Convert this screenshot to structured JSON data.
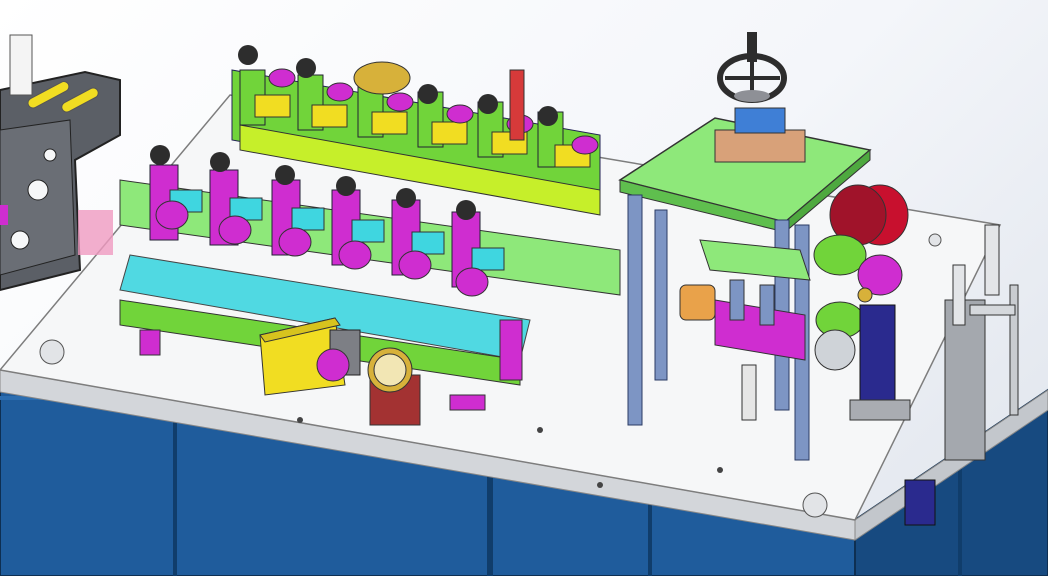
{
  "viewport": {
    "background_top": "#ffffff",
    "background_bottom": "#dfe4ec"
  },
  "machine": {
    "colors": {
      "table_top": "#f6f7f8",
      "table_edge": "#d3d6da",
      "cabinet": "#1f5c9c",
      "cabinet_dark": "#174a80",
      "frame_gray": "#5b5f66",
      "green": "#71d43a",
      "lime": "#c6ef2a",
      "magenta": "#cf2dd0",
      "cyan": "#3fd6e0",
      "yellow": "#f1dd22",
      "light_green": "#8ee87a",
      "column_blue": "#7d95c4",
      "red": "#d63a3a",
      "gold": "#d7b13a",
      "navy": "#2a2a8e",
      "dark_knob": "#2d2d2d",
      "maroon": "#a33232",
      "pink": "#f09ac0",
      "orange": "#e9a24a",
      "tan": "#d8a179"
    },
    "components": [
      "work-table",
      "base-cabinet",
      "left-spool-frame",
      "upper-clamp-row",
      "lower-clamp-row",
      "motor-box",
      "dial-gauge",
      "press-plate",
      "handwheel",
      "gear-train",
      "right-guide-rollers"
    ]
  }
}
